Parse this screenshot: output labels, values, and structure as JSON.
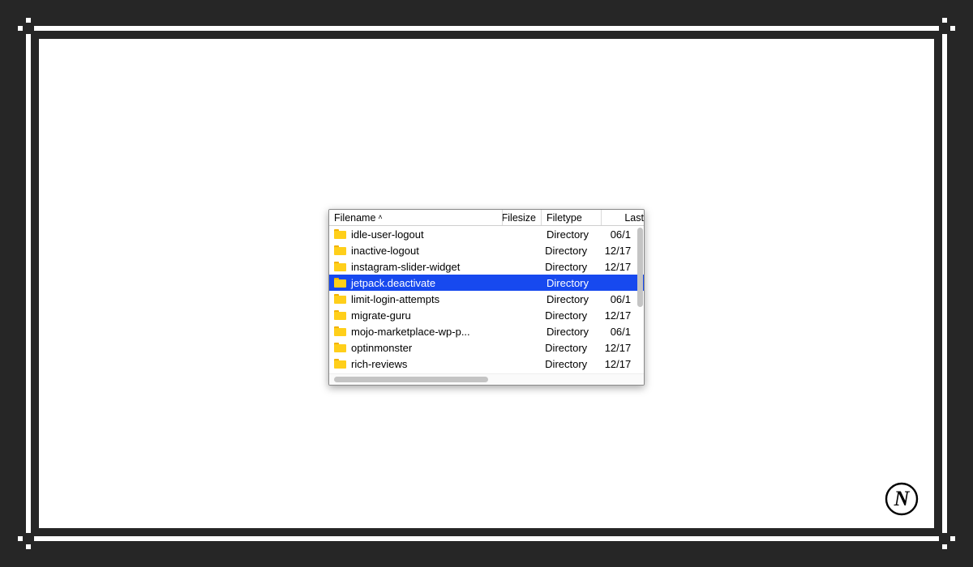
{
  "columns": {
    "filename": "Filename",
    "filesize": "Filesize",
    "filetype": "Filetype",
    "last": "Last"
  },
  "sort": {
    "column": "filename",
    "direction": "asc",
    "caret": "˄"
  },
  "rows": [
    {
      "name": "idle-user-logout",
      "filesize": "",
      "filetype": "Directory",
      "last": "06/1",
      "selected": false
    },
    {
      "name": "inactive-logout",
      "filesize": "",
      "filetype": "Directory",
      "last": "12/17",
      "selected": false
    },
    {
      "name": "instagram-slider-widget",
      "filesize": "",
      "filetype": "Directory",
      "last": "12/17",
      "selected": false
    },
    {
      "name": "jetpack.deactivate",
      "filesize": "",
      "filetype": "Directory",
      "last": "",
      "selected": true
    },
    {
      "name": "limit-login-attempts",
      "filesize": "",
      "filetype": "Directory",
      "last": "06/1",
      "selected": false
    },
    {
      "name": "migrate-guru",
      "filesize": "",
      "filetype": "Directory",
      "last": "12/17",
      "selected": false
    },
    {
      "name": "mojo-marketplace-wp-p...",
      "filesize": "",
      "filetype": "Directory",
      "last": "06/1",
      "selected": false
    },
    {
      "name": "optinmonster",
      "filesize": "",
      "filetype": "Directory",
      "last": "12/17",
      "selected": false
    },
    {
      "name": "rich-reviews",
      "filesize": "",
      "filetype": "Directory",
      "last": "12/17",
      "selected": false
    }
  ],
  "colors": {
    "frame": "#262626",
    "selection": "#1749ef",
    "folder": "#ffcf1a"
  },
  "watermark": {
    "letter": "N"
  }
}
